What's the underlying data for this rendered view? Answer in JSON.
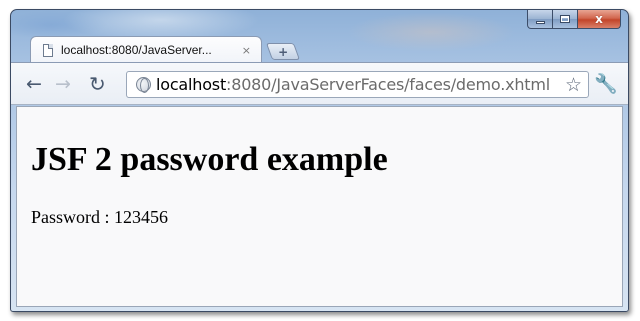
{
  "window": {
    "controls": {
      "minimize": "",
      "maximize": "",
      "close": "x"
    }
  },
  "tab": {
    "title": "localhost:8080/JavaServer...",
    "close_glyph": "×",
    "new_tab_glyph": "+"
  },
  "toolbar": {
    "back_glyph": "←",
    "forward_glyph": "→",
    "reload_glyph": "↻",
    "url_host": "localhost",
    "url_rest": ":8080/JavaServerFaces/faces/demo.xhtml",
    "star_glyph": "☆",
    "wrench_glyph": "🔧"
  },
  "page": {
    "heading": "JSF 2 password example",
    "password_label": "Password",
    "password_separator": " : ",
    "password_value": "123456"
  },
  "icons": [
    "page-icon",
    "close-icon",
    "new-tab-icon",
    "back-icon",
    "forward-icon",
    "reload-icon",
    "globe-icon",
    "star-icon",
    "wrench-icon",
    "minimize-icon",
    "maximize-icon"
  ],
  "colors": {
    "titlebar": "#a7c2e2",
    "close_button": "#c3452a",
    "url_host": "#000000",
    "url_rest": "#6b6b6b",
    "content_bg": "#f9f9fa"
  }
}
